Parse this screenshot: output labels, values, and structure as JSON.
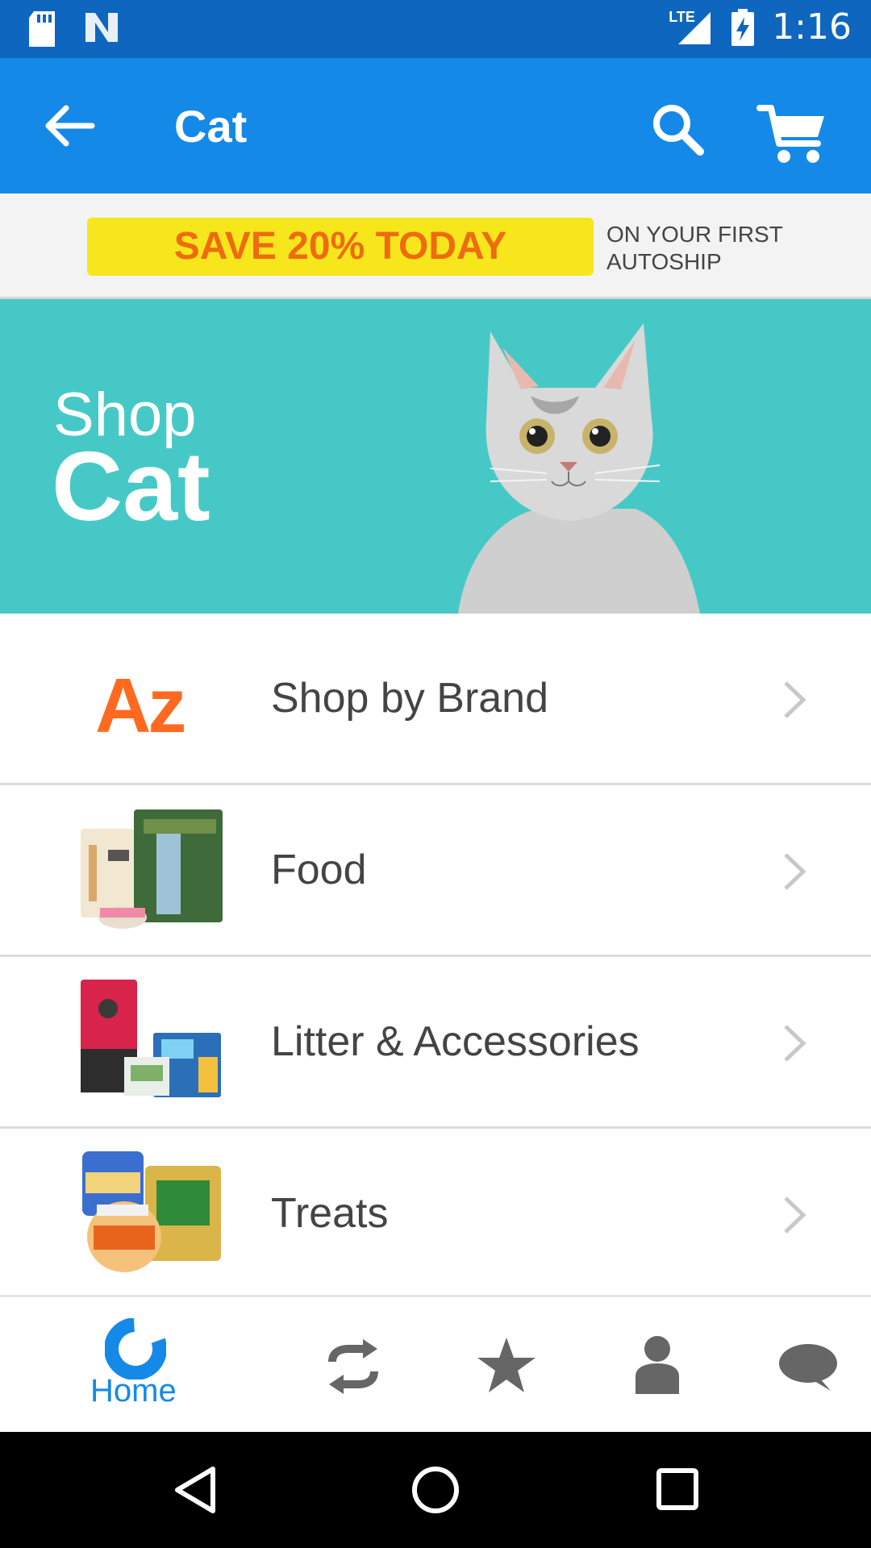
{
  "status_bar": {
    "time": "1:16",
    "network": "LTE"
  },
  "app_bar": {
    "title": "Cat"
  },
  "promo": {
    "badge": "SAVE 20% TODAY",
    "subtext": "ON YOUR FIRST AUTOSHIP"
  },
  "hero": {
    "line1": "Shop",
    "line2": "Cat"
  },
  "categories": [
    {
      "label": "Shop by Brand",
      "icon": "az-brand-icon"
    },
    {
      "label": "Food",
      "icon": "cat-food-products-image"
    },
    {
      "label": "Litter & Accessories",
      "icon": "litter-products-image"
    },
    {
      "label": "Treats",
      "icon": "treats-products-image"
    }
  ],
  "bottom_nav": {
    "items": [
      {
        "label": "Home",
        "icon": "home-icon",
        "active": true
      },
      {
        "label": "",
        "icon": "autoship-icon"
      },
      {
        "label": "",
        "icon": "star-icon"
      },
      {
        "label": "",
        "icon": "profile-icon"
      },
      {
        "label": "",
        "icon": "chat-icon"
      }
    ]
  },
  "colors": {
    "primary": "#1589e8",
    "status_bar": "#0f66bf",
    "promo_yellow": "#f7e61c",
    "promo_orange": "#ee6b10",
    "hero_teal": "#46c9c6",
    "brand_orange": "#ff6a20"
  }
}
